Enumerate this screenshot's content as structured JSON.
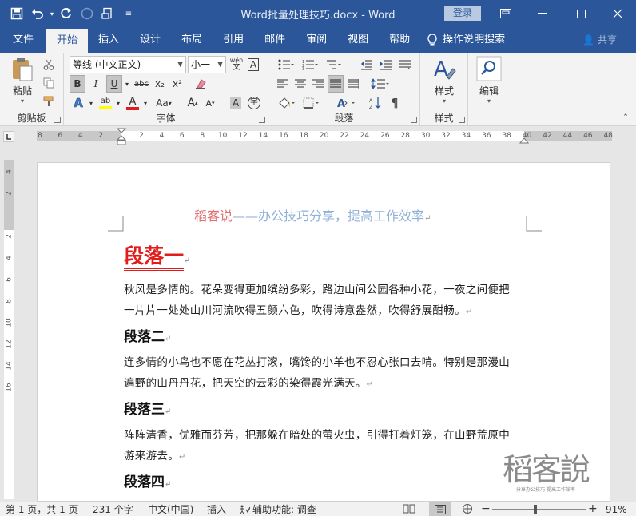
{
  "title_bar": {
    "document_title": "Word批量处理技巧.docx  -  Word",
    "login_label": "登录"
  },
  "tabs": [
    "文件",
    "开始",
    "插入",
    "设计",
    "布局",
    "引用",
    "邮件",
    "审阅",
    "视图",
    "帮助"
  ],
  "active_tab": "开始",
  "tell_me": "操作说明搜索",
  "share": "共享",
  "ribbon": {
    "clipboard": {
      "label": "剪贴板",
      "paste_label": "粘贴"
    },
    "font": {
      "label": "字体",
      "font_name": "等线 (中文正文)",
      "font_size": "小一",
      "wen_glyph": "wén",
      "bold": "B",
      "italic": "I",
      "underline": "U",
      "strike": "abc",
      "sub": "x₂",
      "sup": "x²",
      "case": "Aa",
      "grow": "A",
      "shrink": "A",
      "char_shade": "A",
      "enclose": "字"
    },
    "paragraph": {
      "label": "段落"
    },
    "styles": {
      "label": "样式",
      "button": "样式"
    },
    "editing": {
      "button": "编辑"
    }
  },
  "ruler": {
    "labels": [
      "8",
      "6",
      "4",
      "2",
      "",
      "2",
      "4",
      "6",
      "8",
      "10",
      "12",
      "14",
      "16",
      "18",
      "20",
      "22",
      "24",
      "26",
      "28",
      "30",
      "32",
      "34",
      "36",
      "38",
      "40",
      "42",
      "44",
      "46",
      "48"
    ]
  },
  "vruler": {
    "labels": [
      "4",
      "2",
      "",
      "2",
      "4",
      "6",
      "8",
      "10",
      "12",
      "14",
      "16"
    ]
  },
  "document": {
    "header_red": "稻客说",
    "header_rest": "——办公技巧分享，提高工作效率",
    "heading1": "段落一",
    "para1_line1": "秋风是多情的。花朵变得更加缤纷多彩，路边山间公园各种小花，一夜之间便把",
    "para1_line2": "一片片一处处山川河流吹得五颜六色，吹得诗意盎然，吹得舒展酣畅。",
    "heading2": "段落二",
    "para2_line1": "连多情的小鸟也不愿在花丛打滚，嘴馋的小羊也不忍心张口去啃。特别是那漫山",
    "para2_line2": "遍野的山丹丹花，把天空的云彩的染得霞光满天。",
    "heading3": "段落三",
    "para3_line1": "阵阵清香，优雅而芬芳，把那躲在暗处的萤火虫，引得打着灯笼，在山野荒原中",
    "para3_line2": "游来游去。",
    "heading4": "段落四",
    "para_mark": "↵",
    "watermark_big": "稻客說",
    "watermark_small": "分享办公技巧  提高工作效率"
  },
  "status_bar": {
    "pages": "第 1 页，共 1 页",
    "words": "231 个字",
    "language": "中文(中国)",
    "mode": "插入",
    "accessibility": "辅助功能: 调查",
    "zoom": "91%",
    "zoom_level": 0.91
  },
  "colors": {
    "word_blue": "#2b579a",
    "heading_red": "#e21b1b",
    "header_blue": "#8fb0d8"
  }
}
